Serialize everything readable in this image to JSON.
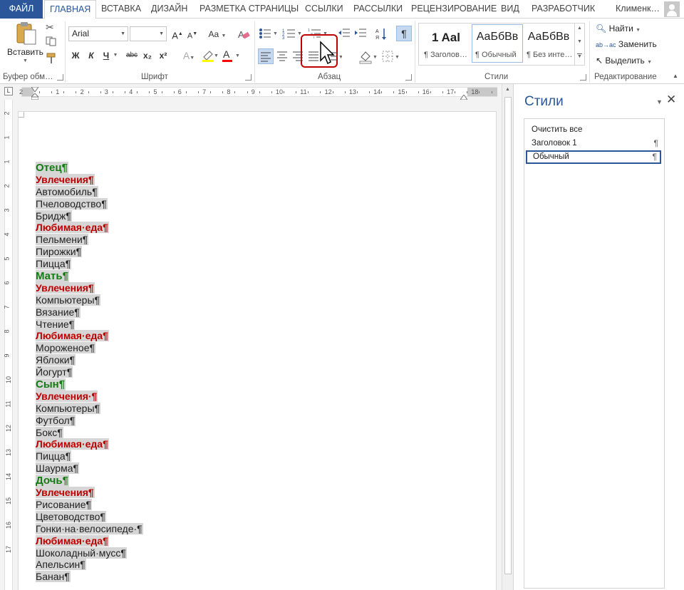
{
  "tabs": {
    "file": "ФАЙЛ",
    "items": [
      "ГЛАВНАЯ",
      "ВСТАВКА",
      "ДИЗАЙН",
      "РАЗМЕТКА СТРАНИЦЫ",
      "ССЫЛКИ",
      "РАССЫЛКИ",
      "РЕЦЕНЗИРОВАНИЕ",
      "ВИД",
      "РАЗРАБОТЧИК"
    ],
    "active": "ГЛАВНАЯ",
    "user": "Клименк…"
  },
  "ribbon": {
    "clipboard": {
      "paste_label": "Вставить",
      "group_label": "Буфер обм…"
    },
    "font": {
      "font_name": "Arial",
      "font_size": "",
      "group_label": "Шрифт",
      "buttons": [
        "Ж",
        "К",
        "Ч",
        "abc",
        "x₂",
        "x²",
        "A",
        "Aa"
      ]
    },
    "paragraph": {
      "group_label": "Абзац"
    },
    "styles": {
      "group_label": "Стили",
      "tiles": [
        {
          "preview": "1 Aal",
          "name": "¶ Заголов…"
        },
        {
          "preview": "АаБбВв",
          "name": "¶ Обычный"
        },
        {
          "preview": "АаБбВв",
          "name": "¶ Без инте…"
        }
      ]
    },
    "editing": {
      "group_label": "Редактирование",
      "find": "Найти",
      "replace": "Заменить",
      "select": "Выделить"
    }
  },
  "ruler": {
    "labels": [
      "1",
      "2",
      "1",
      "2",
      "3",
      "4",
      "5",
      "6",
      "7",
      "8",
      "9",
      "10",
      "11",
      "12",
      "13",
      "14",
      "15",
      "16",
      "17",
      "18"
    ]
  },
  "vruler": {
    "labels": [
      "2",
      "1",
      "1",
      "2",
      "3",
      "4",
      "5",
      "6",
      "7",
      "8",
      "9",
      "10",
      "11",
      "12",
      "13",
      "14",
      "15",
      "16",
      "17"
    ]
  },
  "document": {
    "lines": [
      {
        "text": "Отец¶",
        "level": 1
      },
      {
        "text": "Увлечения¶",
        "level": 2
      },
      {
        "text": "Автомобиль¶",
        "level": 3
      },
      {
        "text": "Пчеловодство¶",
        "level": 3
      },
      {
        "text": "Бридж¶",
        "level": 3
      },
      {
        "text": "Любимая·еда¶",
        "level": 2
      },
      {
        "text": "Пельмени¶",
        "level": 3
      },
      {
        "text": "Пирожки¶",
        "level": 3
      },
      {
        "text": "Пицца¶",
        "level": 3
      },
      {
        "text": "Мать¶",
        "level": 1
      },
      {
        "text": "Увлечения¶",
        "level": 2
      },
      {
        "text": "Компьютеры¶",
        "level": 3
      },
      {
        "text": "Вязание¶",
        "level": 3
      },
      {
        "text": "Чтение¶",
        "level": 3
      },
      {
        "text": "Любимая·еда¶",
        "level": 2
      },
      {
        "text": "Мороженое¶",
        "level": 3
      },
      {
        "text": "Яблоки¶",
        "level": 3
      },
      {
        "text": "Йогурт¶",
        "level": 3
      },
      {
        "text": "Сын¶",
        "level": 1
      },
      {
        "text": "Увлечения·¶",
        "level": 2
      },
      {
        "text": "Компьютеры¶",
        "level": 3
      },
      {
        "text": "Футбол¶",
        "level": 3
      },
      {
        "text": "Бокс¶",
        "level": 3
      },
      {
        "text": "Любимая·еда¶",
        "level": 2
      },
      {
        "text": "Пицца¶",
        "level": 3
      },
      {
        "text": "Шаурма¶",
        "level": 3
      },
      {
        "text": "Дочь¶",
        "level": 1
      },
      {
        "text": "Увлечения¶",
        "level": 2
      },
      {
        "text": "Рисование¶",
        "level": 3
      },
      {
        "text": "Цветоводство¶",
        "level": 3
      },
      {
        "text": "Гонки·на·велосипеде·¶",
        "level": 3
      },
      {
        "text": "Любимая·еда¶",
        "level": 2
      },
      {
        "text": "Шоколадный·мусс¶",
        "level": 3
      },
      {
        "text": "Апельсин¶",
        "level": 3
      },
      {
        "text": "Банан¶",
        "level": 3
      }
    ]
  },
  "styles_pane": {
    "title": "Стили",
    "items": [
      {
        "label": "Очистить все",
        "mark": ""
      },
      {
        "label": "Заголовок 1",
        "mark": "¶"
      },
      {
        "label": "Обычный",
        "mark": "¶"
      }
    ],
    "selected": "Обычный"
  },
  "colors": {
    "accent": "#2b579a",
    "heading1": "#137d13",
    "heading2": "#c00000",
    "highlight_box": "#c00000"
  }
}
